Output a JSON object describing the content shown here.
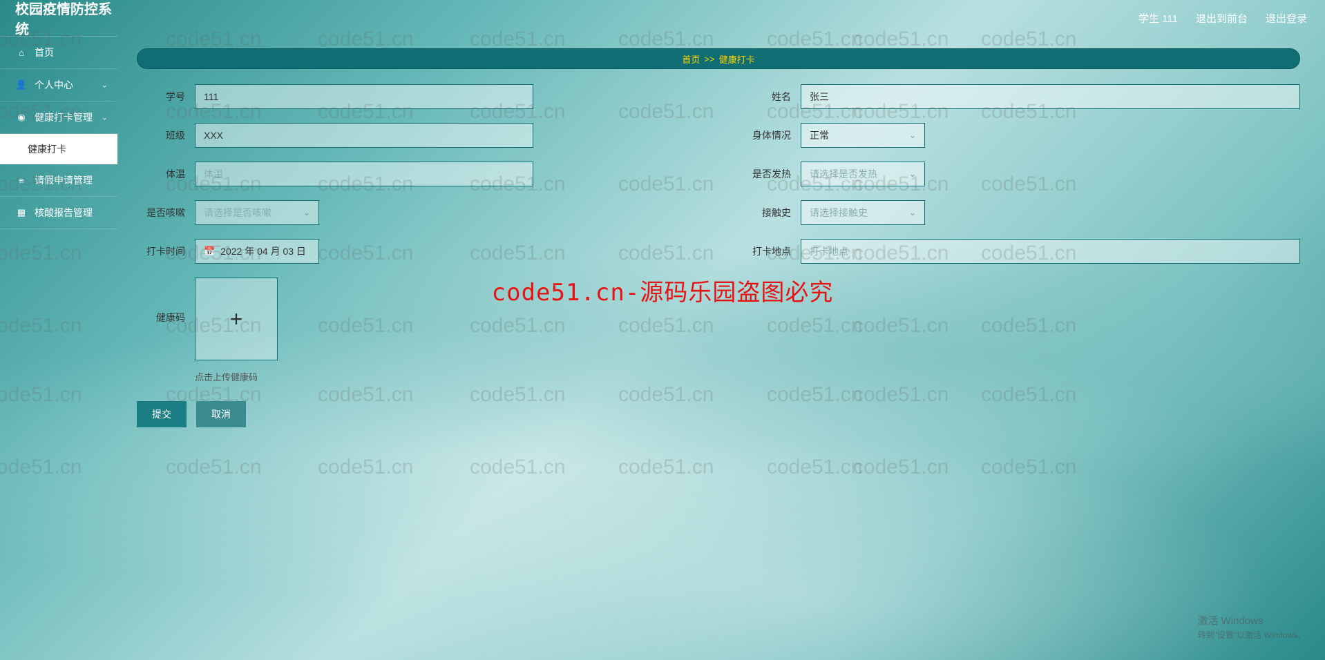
{
  "header": {
    "title": "校园疫情防控系统",
    "user_label": "学生 111",
    "link_front": "退出到前台",
    "link_logout": "退出登录"
  },
  "sidebar": {
    "items": [
      {
        "icon": "⌂",
        "label": "首页",
        "expandable": false
      },
      {
        "icon": "👤",
        "label": "个人中心",
        "expandable": true
      },
      {
        "icon": "◉",
        "label": "健康打卡管理",
        "expandable": true
      },
      {
        "icon": "≡",
        "label": "请假申请管理",
        "expandable": false
      },
      {
        "icon": "▦",
        "label": "核酸报告管理",
        "expandable": false
      }
    ],
    "active_sub": "健康打卡"
  },
  "breadcrumb": {
    "home": "首页",
    "sep": ">>",
    "page": "健康打卡"
  },
  "form": {
    "student_id": {
      "label": "学号",
      "value": "111"
    },
    "name": {
      "label": "姓名",
      "value": "张三"
    },
    "class": {
      "label": "班级",
      "value": "XXX"
    },
    "body": {
      "label": "身体情况",
      "value": "正常"
    },
    "temp": {
      "label": "体温",
      "placeholder": "体温"
    },
    "fever": {
      "label": "是否发热",
      "placeholder": "请选择是否发热"
    },
    "cough": {
      "label": "是否咳嗽",
      "placeholder": "请选择是否咳嗽"
    },
    "contact": {
      "label": "接触史",
      "placeholder": "请选择接触史"
    },
    "time": {
      "label": "打卡时间",
      "value": "2022 年 04 月 03 日"
    },
    "location": {
      "label": "打卡地点",
      "placeholder": "打卡地点"
    },
    "qrcode": {
      "label": "健康码",
      "hint": "点击上传健康码"
    }
  },
  "buttons": {
    "submit": "提交",
    "cancel": "取消"
  },
  "watermark": {
    "text": "code51.cn",
    "center": "code51.cn-源码乐园盗图必究"
  },
  "activate": {
    "line1": "激活 Windows",
    "line2": "转到\"设置\"以激活 Windows。"
  }
}
